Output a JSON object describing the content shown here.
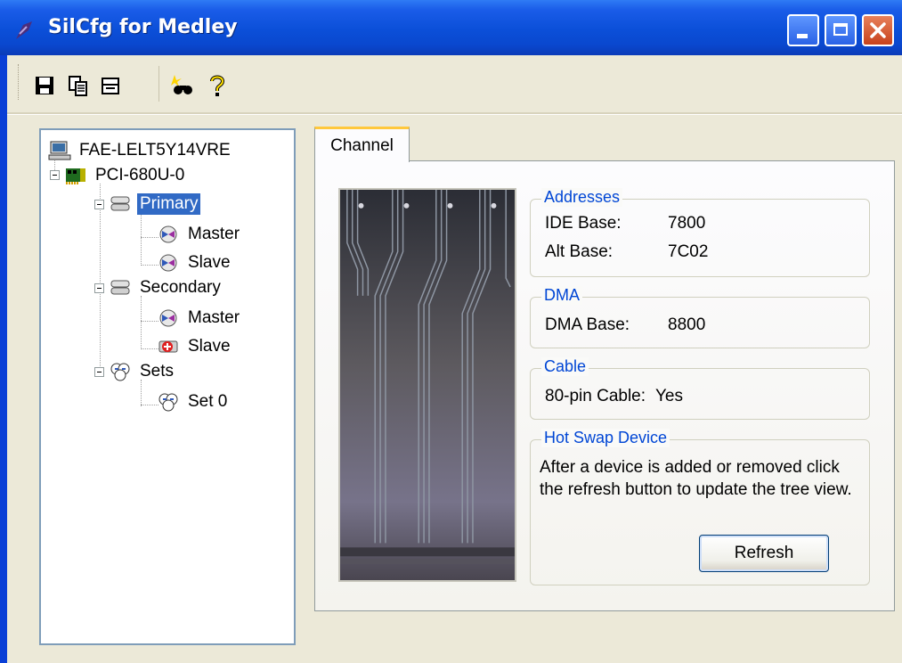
{
  "window": {
    "title": "SilCfg for Medley"
  },
  "toolbar": {
    "icons": [
      "save-icon",
      "copy-icon",
      "print-icon",
      "scan-icon",
      "help-icon"
    ]
  },
  "tree": {
    "root": "FAE-LELT5Y14VRE",
    "adapter": "PCI-680U-0",
    "primary": {
      "label": "Primary",
      "master": "Master",
      "slave": "Slave"
    },
    "secondary": {
      "label": "Secondary",
      "master": "Master",
      "slave": "Slave"
    },
    "sets": {
      "label": "Sets",
      "set0": "Set 0"
    },
    "selected": "Primary"
  },
  "tab": {
    "label": "Channel"
  },
  "addresses": {
    "legend": "Addresses",
    "ide_base_label": "IDE Base:",
    "ide_base_value": "7800",
    "alt_base_label": "Alt Base:",
    "alt_base_value": "7C02"
  },
  "dma": {
    "legend": "DMA",
    "dma_base_label": "DMA Base:",
    "dma_base_value": "8800"
  },
  "cable": {
    "legend": "Cable",
    "label": "80-pin Cable:",
    "value": "Yes"
  },
  "hotswap": {
    "legend": "Hot Swap Device",
    "text": "After a device is added or removed click the refresh button to update the tree view.",
    "refresh_label": "Refresh"
  },
  "colors": {
    "titlebar": "#0b4fd8",
    "selection": "#316ac5",
    "legend": "#0046d5",
    "tab_accent": "#ffc83c"
  }
}
